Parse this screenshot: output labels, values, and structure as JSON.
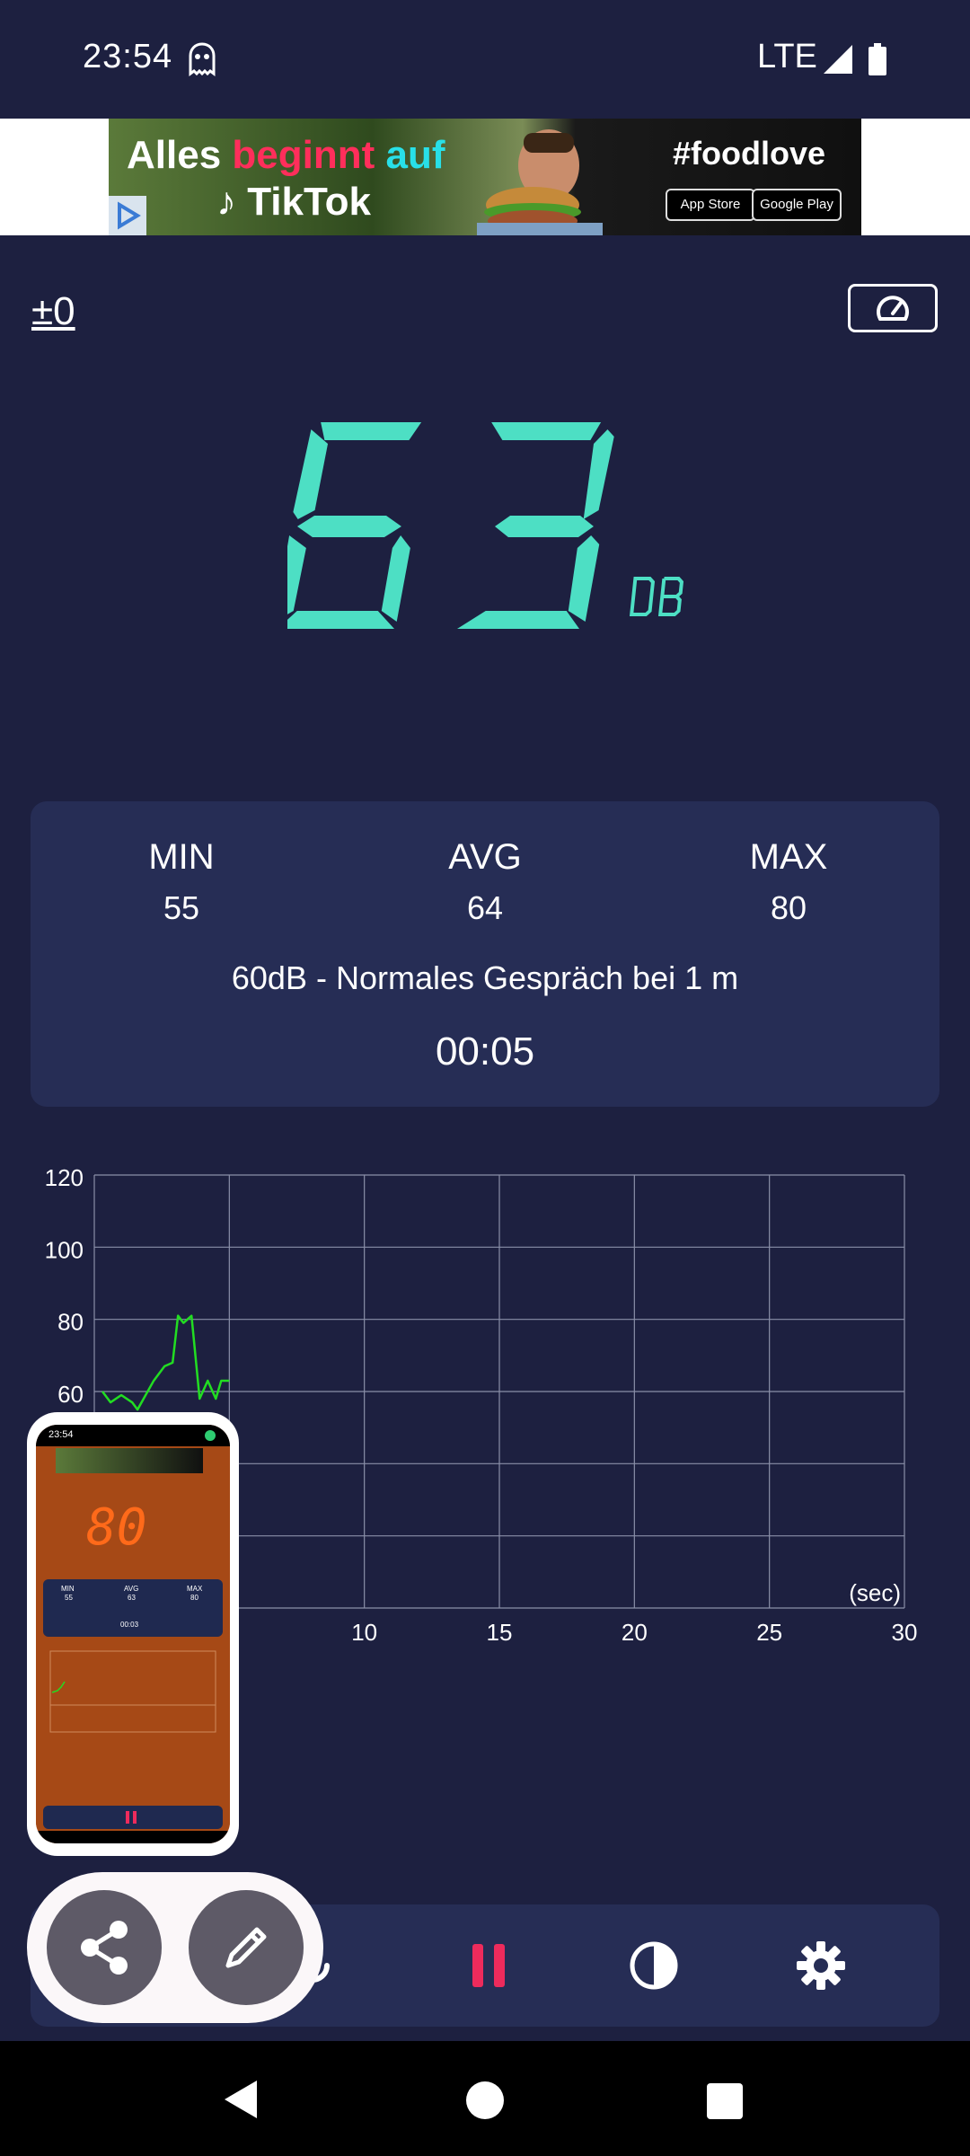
{
  "status_bar": {
    "time": "23:54",
    "network": "LTE",
    "icons": [
      "ghost-icon",
      "signal-icon",
      "battery-icon"
    ]
  },
  "ad": {
    "line1_a": "Alles ",
    "line1_b": "beginnt ",
    "line1_c": "auf",
    "line2": "♪ TikTok",
    "hashtag": "#foodlove",
    "store1": "App Store",
    "store2": "Google Play"
  },
  "meter": {
    "calibration": "±0",
    "reading": "63",
    "unit": "DB"
  },
  "stats": {
    "min_label": "MIN",
    "min_value": "55",
    "avg_label": "AVG",
    "avg_value": "64",
    "max_label": "MAX",
    "max_value": "80",
    "description": "60dB - Normales Gespräch bei 1 m",
    "timer": "00:05"
  },
  "chart_data": {
    "type": "line",
    "xlim": [
      0,
      30
    ],
    "ylim": [
      0,
      120
    ],
    "x_ticks": [
      "10",
      "15",
      "20",
      "25",
      "30"
    ],
    "y_ticks": [
      "120",
      "100",
      "80",
      "60"
    ],
    "xlabel": "(sec)",
    "grid": true,
    "series": [
      {
        "color": "#22dd22",
        "x": [
          0.3,
          0.6,
          1.0,
          1.4,
          1.6,
          1.9,
          2.2,
          2.6,
          2.9,
          3.1,
          3.3,
          3.6,
          3.9,
          4.2,
          4.5,
          4.7,
          5.0
        ],
        "y": [
          60,
          57,
          59,
          57,
          55,
          59,
          63,
          67,
          68,
          81,
          79,
          81,
          58,
          63,
          58,
          63,
          63
        ]
      }
    ],
    "color": "#22dd22"
  },
  "preview": {
    "time": "23:54",
    "reading": "80",
    "min_label": "MIN",
    "min_value": "55",
    "avg_label": "AVG",
    "avg_value": "63",
    "max_label": "MAX",
    "max_value": "80",
    "timer": "00:03"
  },
  "colors": {
    "background": "#1d2040",
    "card": "#262d55",
    "digits": "#4ddfc4",
    "pause": "#ee2b5c"
  }
}
